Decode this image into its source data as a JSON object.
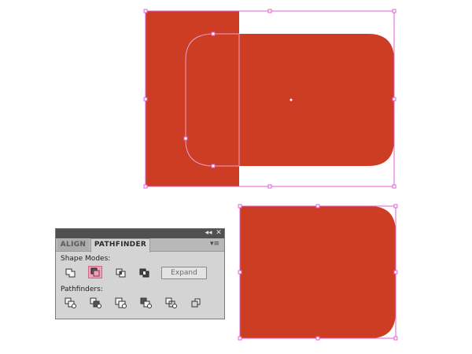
{
  "panel": {
    "tabs": {
      "align": "ALIGN",
      "pathfinder": "PATHFINDER"
    },
    "controls": {
      "collapse": "◂◂",
      "close": "✕",
      "menu": "▾≡"
    },
    "shape_modes_label": "Shape Modes:",
    "pathfinders_label": "Pathfinders:",
    "expand_label": "Expand",
    "shape_mode_buttons": [
      "unite",
      "minus-front",
      "intersect",
      "exclude"
    ],
    "selected_shape_mode": "minus-front",
    "pathfinder_buttons": [
      "divide",
      "trim",
      "merge",
      "crop",
      "outline",
      "minus-back"
    ]
  },
  "colors": {
    "shape_fill": "#cc3d24",
    "selection": "#e25fd0",
    "selected_button": "#f2a2b6"
  }
}
